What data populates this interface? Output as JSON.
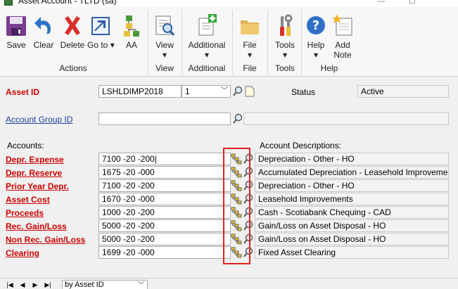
{
  "window": {
    "title": "Asset Account  -  TLTD (sa)",
    "minimize": "—",
    "maximize": "☐"
  },
  "ribbon": {
    "save": "Save",
    "clear": "Clear",
    "delete": "Delete",
    "goto": "Go to",
    "aa": "AA",
    "actions_group": "Actions",
    "view": "View",
    "view_group": "View",
    "additional": "Additional",
    "additional_group": "Additional",
    "file": "File",
    "file_group": "File",
    "tools": "Tools",
    "tools_group": "Tools",
    "help": "Help",
    "add_note_line1": "Add",
    "add_note_line2": "Note",
    "help_group": "Help"
  },
  "form": {
    "asset_id_label": "Asset ID",
    "asset_id_value": "LSHLDIMP2018",
    "suffix_value": "1",
    "status_label": "Status",
    "status_value": "Active",
    "account_group_label": "Account Group ID",
    "account_group_value": "",
    "accounts_header": "Accounts:",
    "descriptions_header": "Account Descriptions:",
    "accounts": [
      {
        "label": "Depr. Expense",
        "value": "7100 -20 -200|",
        "description": "Depreciation - Other - HO"
      },
      {
        "label": "Depr. Reserve",
        "value": "1675 -20 -000",
        "description": "Accumulated Depreciation - Leasehold Improvements"
      },
      {
        "label": "Prior Year Depr.",
        "value": "7100 -20 -200",
        "description": "Depreciation - Other - HO"
      },
      {
        "label": "Asset Cost",
        "value": "1670 -20 -000",
        "description": "Leasehold Improvements"
      },
      {
        "label": "Proceeds",
        "value": "1000 -20 -200",
        "description": "Cash - Scotiabank Chequing - CAD"
      },
      {
        "label": "Rec. Gain/Loss",
        "value": "5000 -20 -200",
        "description": "Gain/Loss on Asset Disposal - HO"
      },
      {
        "label": "Non Rec. Gain/Loss",
        "value": "5000 -20 -200",
        "description": "Gain/Loss on Asset Disposal - HO"
      },
      {
        "label": "Clearing",
        "value": "1699 -20 -000",
        "description": "Fixed Asset Clearing"
      }
    ]
  },
  "bottom": {
    "sort_option": "by Asset ID"
  },
  "colors": {
    "required_label": "#cc0000",
    "link": "#1a3fa0",
    "highlight_box": "#e02020"
  }
}
